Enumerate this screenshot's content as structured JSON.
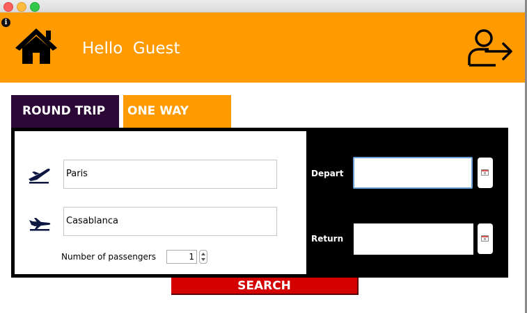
{
  "window": {
    "traffic_lights": [
      "close",
      "minimize",
      "maximize"
    ]
  },
  "header": {
    "greeting": "Hello  Guest",
    "background_color": "#ff9a00",
    "icons": [
      "info-icon",
      "home-icon",
      "logout-icon"
    ]
  },
  "tabs": {
    "round_trip": "ROUND TRIP",
    "one_way": "ONE WAY",
    "active_color": "#2c0836",
    "inactive_color": "#ff9a00"
  },
  "form": {
    "from_value": "Paris",
    "to_value": "Casablanca",
    "passengers_label": "Number of passengers",
    "passengers_value": "1",
    "depart_label": "Depart",
    "depart_value": "",
    "return_label": "Return",
    "return_value": ""
  },
  "search_button": {
    "label": "SEARCH",
    "color": "#d40000"
  }
}
